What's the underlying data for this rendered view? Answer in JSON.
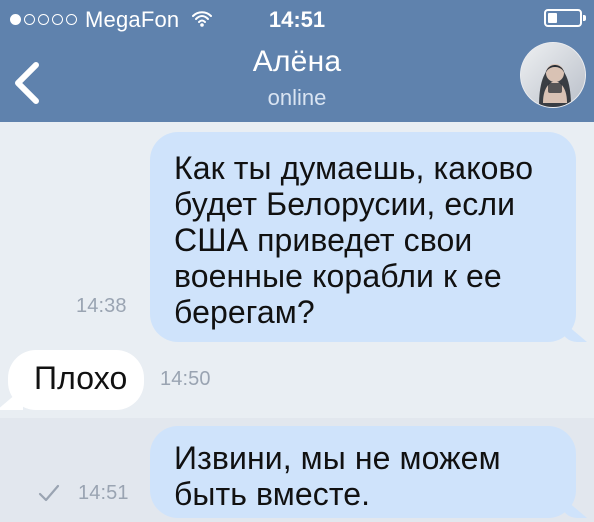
{
  "status_bar": {
    "carrier": "MegaFon",
    "time": "14:51"
  },
  "header": {
    "contact_name": "Алёна",
    "contact_status": "online"
  },
  "messages": [
    {
      "direction": "outgoing",
      "text": "Как ты думаешь, каково\nбудет Белорусии, если\nСША  приведет свои\nвоенные корабли к ее\nберегам?",
      "time": "14:38"
    },
    {
      "direction": "incoming",
      "text": "Плохо",
      "time": "14:50"
    },
    {
      "direction": "outgoing",
      "text": "Извини, мы не можем\nбыть вместе.",
      "time": "14:51"
    }
  ],
  "colors": {
    "header_bg": "#5f82ad",
    "chat_bg": "#e9eef3",
    "outgoing_bubble": "#cfe3fb",
    "incoming_bubble": "#ffffff"
  }
}
